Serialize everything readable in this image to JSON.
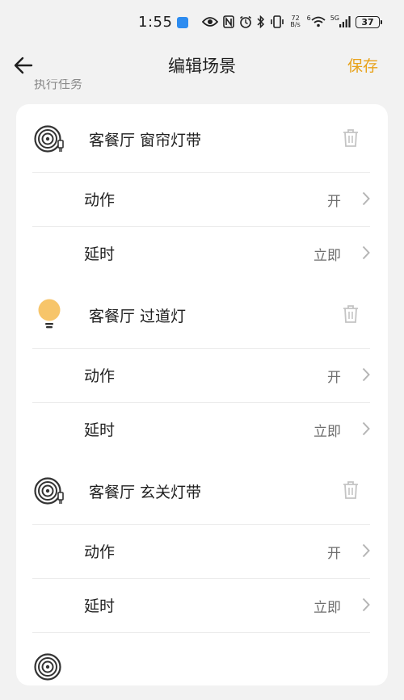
{
  "status_bar": {
    "time": "1:55",
    "net_speed_top": "72",
    "net_speed_bottom": "B/s",
    "wifi_label": "6",
    "signal_label": "5G",
    "battery": "37"
  },
  "header": {
    "title": "编辑场景",
    "back_icon": "arrow-left-icon",
    "save_label": "保存"
  },
  "section": {
    "label": "执行任务"
  },
  "colors": {
    "accent": "#e8a21a",
    "bulb": "#f7c56a",
    "card_bg": "#ffffff",
    "page_bg": "#f2f2f2"
  },
  "tasks": [
    {
      "device": "客餐厅 窗帘灯带",
      "icon": "light-strip-icon",
      "action_label": "动作",
      "action_value": "开",
      "delay_label": "延时",
      "delay_value": "立即"
    },
    {
      "device": "客餐厅 过道灯",
      "icon": "light-bulb-icon",
      "action_label": "动作",
      "action_value": "开",
      "delay_label": "延时",
      "delay_value": "立即"
    },
    {
      "device": "客餐厅 玄关灯带",
      "icon": "light-strip-icon",
      "action_label": "动作",
      "action_value": "开",
      "delay_label": "延时",
      "delay_value": "立即"
    }
  ],
  "partial_task": {
    "icon": "light-strip-icon"
  }
}
